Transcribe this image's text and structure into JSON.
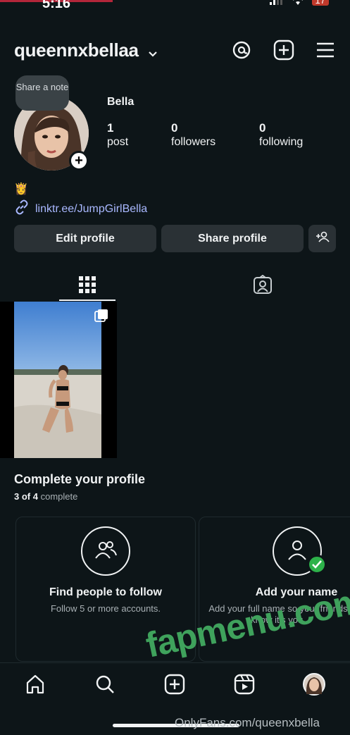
{
  "status": {
    "time": "5:16",
    "battery": "17"
  },
  "header": {
    "username": "queennxbellaa"
  },
  "profile": {
    "note": "Share a note",
    "name": "Bella",
    "posts": {
      "count": "1",
      "label": "post"
    },
    "followers": {
      "count": "0",
      "label": "followers"
    },
    "following": {
      "count": "0",
      "label": "following"
    },
    "bio_emoji": "👸",
    "link": "linktr.ee/JumpGirlBella"
  },
  "buttons": {
    "edit": "Edit profile",
    "share": "Share profile"
  },
  "complete": {
    "title": "Complete your profile",
    "done": "3 of 4",
    "suffix": "complete"
  },
  "cards": [
    {
      "title": "Find people to follow",
      "subtitle": "Follow 5 or more accounts."
    },
    {
      "title": "Add your name",
      "subtitle": "Add your full name so your friends know it's you."
    }
  ],
  "watermark": {
    "site": "fapmenu.com",
    "source": "OnlyFans.com/queenxbella"
  },
  "colors": {
    "background": "#0d1518",
    "link": "#a9b8ff",
    "check": "#2db24a",
    "button": "#2a3135"
  }
}
